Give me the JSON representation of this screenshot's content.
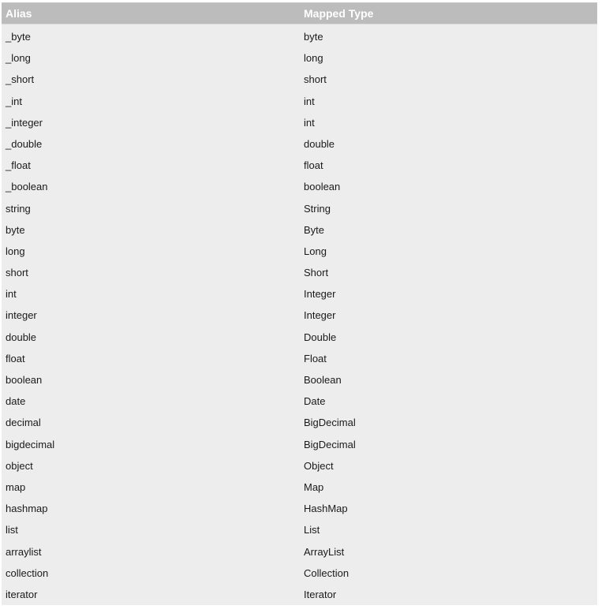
{
  "table": {
    "columns": [
      {
        "key": "alias",
        "label": "Alias"
      },
      {
        "key": "mapped",
        "label": "Mapped Type"
      }
    ],
    "header_background": "#bcbcbc",
    "header_text_color": "#ffffff",
    "body_background": "#ededed",
    "body_text_color": "#1a1a1a",
    "row_count": 27,
    "rows": [
      {
        "alias": "_byte",
        "mapped": "byte"
      },
      {
        "alias": "_long",
        "mapped": "long"
      },
      {
        "alias": "_short",
        "mapped": "short"
      },
      {
        "alias": "_int",
        "mapped": "int"
      },
      {
        "alias": "_integer",
        "mapped": "int"
      },
      {
        "alias": "_double",
        "mapped": "double"
      },
      {
        "alias": "_float",
        "mapped": "float"
      },
      {
        "alias": "_boolean",
        "mapped": "boolean"
      },
      {
        "alias": "string",
        "mapped": "String"
      },
      {
        "alias": "byte",
        "mapped": "Byte"
      },
      {
        "alias": "long",
        "mapped": "Long"
      },
      {
        "alias": "short",
        "mapped": "Short"
      },
      {
        "alias": "int",
        "mapped": "Integer"
      },
      {
        "alias": "integer",
        "mapped": "Integer"
      },
      {
        "alias": "double",
        "mapped": "Double"
      },
      {
        "alias": "float",
        "mapped": "Float"
      },
      {
        "alias": "boolean",
        "mapped": "Boolean"
      },
      {
        "alias": "date",
        "mapped": "Date"
      },
      {
        "alias": "decimal",
        "mapped": "BigDecimal"
      },
      {
        "alias": "bigdecimal",
        "mapped": "BigDecimal"
      },
      {
        "alias": "object",
        "mapped": "Object"
      },
      {
        "alias": "map",
        "mapped": "Map"
      },
      {
        "alias": "hashmap",
        "mapped": "HashMap"
      },
      {
        "alias": "list",
        "mapped": "List"
      },
      {
        "alias": "arraylist",
        "mapped": "ArrayList"
      },
      {
        "alias": "collection",
        "mapped": "Collection"
      },
      {
        "alias": "iterator",
        "mapped": "Iterator"
      }
    ]
  }
}
